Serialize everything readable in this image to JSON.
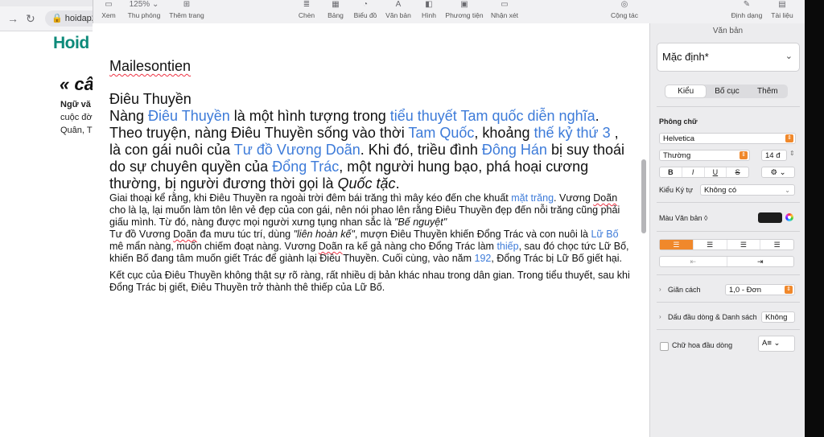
{
  "browser": {
    "url": "hoidap2",
    "logo_main": "Hoid",
    "heading": "« câ",
    "line1": "Ngữ vă",
    "line2": "cuộc đờ",
    "line3": "Quân, T"
  },
  "toolbar": {
    "items": [
      {
        "label": "Xem",
        "icon": "▭"
      },
      {
        "label": "Thu phóng",
        "icon": "125% ⌄"
      },
      {
        "label": "Thêm trang",
        "icon": "⊞"
      },
      {
        "label": "Chèn",
        "icon": "≣"
      },
      {
        "label": "Bảng",
        "icon": "▦"
      },
      {
        "label": "Biểu đồ",
        "icon": "◔"
      },
      {
        "label": "Văn bản",
        "icon": "A"
      },
      {
        "label": "Hình",
        "icon": "◧"
      },
      {
        "label": "Phương tiện",
        "icon": "▣"
      },
      {
        "label": "Nhận xét",
        "icon": "▭"
      },
      {
        "label": "Cộng tác",
        "icon": "◎"
      },
      {
        "label": "Định dạng",
        "icon": "✎"
      },
      {
        "label": "Tài liệu",
        "icon": "▤"
      }
    ]
  },
  "document": {
    "name": "Mailesontien",
    "title": "Điêu Thuyền",
    "para1": [
      {
        "t": "Nàng ",
        "link": false
      },
      {
        "t": "Điêu Thuyền",
        "link": true
      },
      {
        "t": " là một hình tượng trong ",
        "link": false
      },
      {
        "t": "tiểu thuyết Tam quốc diễn nghĩa",
        "link": true
      },
      {
        "t": ". Theo truyện, nàng Điêu Thuyền sống vào thời ",
        "link": false
      },
      {
        "t": "Tam Quốc",
        "link": true
      },
      {
        "t": ", khoảng ",
        "link": false
      },
      {
        "t": "thế kỷ thứ 3",
        "link": true
      },
      {
        "t": " , là con gái nuôi của ",
        "link": false
      },
      {
        "t": "Tư đồ Vương Doãn",
        "link": true
      },
      {
        "t": ". Khi đó, triều đình ",
        "link": false
      },
      {
        "t": "Đông Hán",
        "link": true
      },
      {
        "t": " bị suy thoái do sự chuyên quyền của ",
        "link": false
      },
      {
        "t": "Đổng Trác",
        "link": true
      },
      {
        "t": ", một người hung bạo, phá hoại cương thường, bị người đương thời gọi là ",
        "link": false
      },
      {
        "t": "Quốc tặc",
        "italic": true
      },
      {
        "t": ".",
        "link": false
      }
    ],
    "para2": [
      {
        "t": "Giai thoại kể rằng, khi Điêu Thuyền ra ngoài trời đêm bái trăng thì mây kéo đến che khuất ",
        "link": false
      },
      {
        "t": "mặt trăng",
        "link": true
      },
      {
        "t": ". Vương ",
        "link": false
      },
      {
        "t": "Doãn",
        "squiggle": true
      },
      {
        "t": " cho là lạ, lại muốn làm tôn lên vẻ đẹp của con gái, nên nói phao lên rằng Điêu Thuyền đẹp đến nỗi trăng cũng phải giấu mình. Từ đó, nàng được mọi người xưng tụng nhan sắc là ",
        "link": false
      },
      {
        "t": "\"Bế nguyệt\"",
        "italic": true
      }
    ],
    "para3": [
      {
        "t": "Tư đồ Vương ",
        "link": false
      },
      {
        "t": "Doãn",
        "squiggle": true
      },
      {
        "t": " đa mưu túc trí, dùng ",
        "link": false
      },
      {
        "t": "\"liên hoàn kế\"",
        "italic": true
      },
      {
        "t": ", mượn Điêu Thuyền khiến Đổng Trác và con nuôi là ",
        "link": false
      },
      {
        "t": "Lữ Bố",
        "link": true
      },
      {
        "t": " mê mẩn nàng, muốn chiếm đoạt nàng. Vương ",
        "link": false
      },
      {
        "t": "Doãn",
        "squiggle": true
      },
      {
        "t": " ra kế gả nàng cho Đổng Trác làm ",
        "link": false
      },
      {
        "t": "thiếp",
        "link": true
      },
      {
        "t": ", sau đó chọc tức Lữ Bố, khiến Bố đang tâm muốn giết Trác để giành lại Điêu Thuyền. Cuối cùng, vào năm ",
        "link": false
      },
      {
        "t": "192",
        "link": true
      },
      {
        "t": ", Đổng Trác bị Lữ Bố giết hại.",
        "link": false
      }
    ],
    "para4": "Kết cục của Điêu Thuyền không thật sự rõ ràng, rất nhiều dị bản khác nhau trong dân gian. Trong tiểu thuyết, sau khi Đổng Trác bị giết, Điêu Thuyền trở thành thê thiếp của Lữ Bố."
  },
  "sidebar": {
    "title": "Văn bản",
    "style_value": "Mặc định*",
    "tabs": [
      "Kiểu",
      "Bố cục",
      "Thêm"
    ],
    "font_section": "Phông chữ",
    "font_family": "Helvetica",
    "font_style": "Thường",
    "font_size": "14 đ",
    "format_buttons": [
      "B",
      "I",
      "U",
      "S"
    ],
    "char_style_label": "Kiểu Ký tự",
    "char_style_value": "Không có",
    "text_color_label": "Màu Văn bản ◊",
    "spacing_label": "Giãn cách",
    "spacing_value": "1,0 - Đơn",
    "bullets_label": "Dấu đầu dòng & Danh sách",
    "bullets_value": "Không",
    "dropcap_label": "Chữ hoa đầu dòng",
    "accent": "#f0882b"
  }
}
